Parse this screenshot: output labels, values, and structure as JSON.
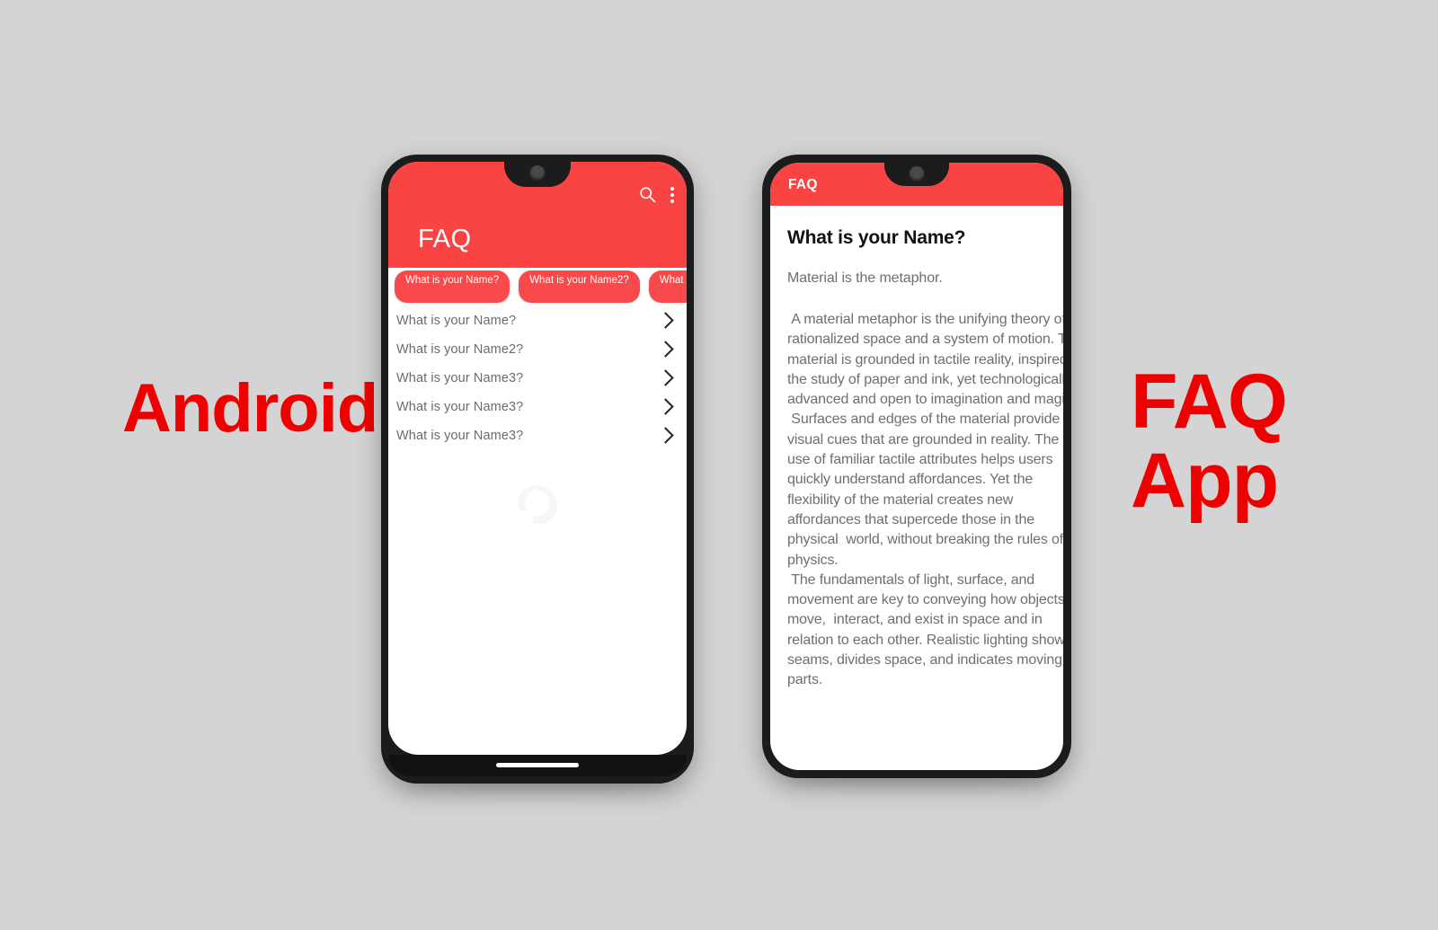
{
  "background_color": "#d4d4d4",
  "accent_color": "#fa4444",
  "caption_color": "#ee0000",
  "captions": {
    "left": "Android",
    "right_line1": "FAQ",
    "right_line2": "App"
  },
  "left_phone": {
    "appbar": {
      "title": "FAQ",
      "search_icon": "search-icon",
      "overflow_icon": "more-vertical-icon"
    },
    "chips": [
      "What is your Name?",
      "What is your Name2?",
      "What is your"
    ],
    "list_items": [
      {
        "label": "What is your Name?",
        "chevron": "chevron-right-icon"
      },
      {
        "label": "What is your Name2?",
        "chevron": "chevron-right-icon"
      },
      {
        "label": "What is your Name3?",
        "chevron": "chevron-right-icon"
      },
      {
        "label": "What is your Name3?",
        "chevron": "chevron-right-icon"
      },
      {
        "label": "What is your Name3?",
        "chevron": "chevron-right-icon"
      }
    ],
    "watermark": "app-logo-watermark",
    "nav_gesture_pill": "gesture-pill"
  },
  "right_phone": {
    "appbar": {
      "title": "FAQ"
    },
    "detail": {
      "title": "What is your Name?",
      "lead": "Material is the metaphor.",
      "body": " A material metaphor is the unifying theory of a rationalized space and a system of motion. The material is grounded in tactile reality, inspired by the study of paper and ink, yet technologically advanced and open to imagination and magic.\n Surfaces and edges of the material provide visual cues that are grounded in reality. The  use of familiar tactile attributes helps users quickly understand affordances. Yet the flexibility of the material creates new affordances that supercede those in the physical  world, without breaking the rules of physics.\n The fundamentals of light, surface, and movement are key to conveying how objects move,  interact, and exist in space and in relation to each other. Realistic lighting shows  seams, divides space, and indicates moving parts."
    }
  }
}
